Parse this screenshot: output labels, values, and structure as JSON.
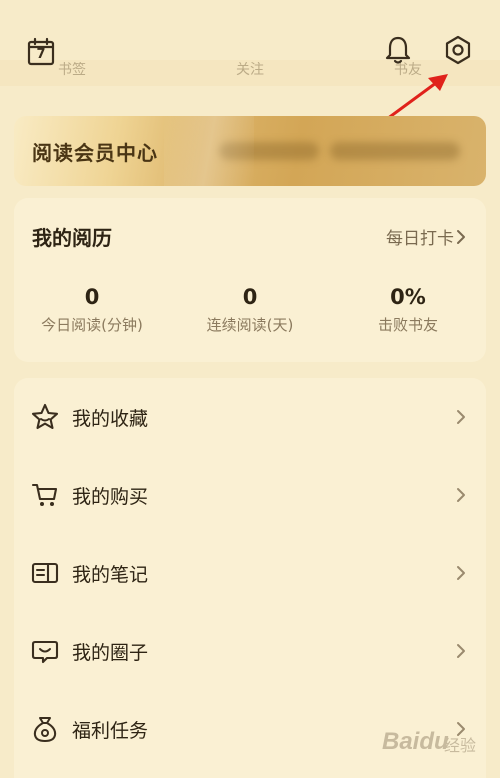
{
  "top_bar": {
    "ghost_tabs": [
      "书签",
      "关注",
      "书友圈"
    ],
    "calendar_day": "7",
    "icons": [
      "calendar-icon",
      "bell-icon",
      "gear-icon"
    ]
  },
  "member_banner": {
    "title": "阅读会员中心"
  },
  "reading_history": {
    "title": "我的阅历",
    "checkin_label": "每日打卡",
    "stats": [
      {
        "value": "0",
        "label": "今日阅读(分钟)"
      },
      {
        "value": "0",
        "label": "连续阅读(天)"
      },
      {
        "value": "0%",
        "label": "击败书友"
      }
    ]
  },
  "menu": [
    {
      "label": "我的收藏",
      "icon": "star-icon"
    },
    {
      "label": "我的购买",
      "icon": "cart-icon"
    },
    {
      "label": "我的笔记",
      "icon": "notes-icon"
    },
    {
      "label": "我的圈子",
      "icon": "chat-icon"
    },
    {
      "label": "福利任务",
      "icon": "money-bag-icon"
    }
  ],
  "colors": {
    "background": "#f7ebc9",
    "card": "#faf0d3",
    "text": "#2e2414",
    "muted": "#8b7a5e",
    "gold": "#d3a656",
    "annotation": "#e0221b"
  },
  "watermark": {
    "logo": "Baidu",
    "sub": "经验"
  }
}
